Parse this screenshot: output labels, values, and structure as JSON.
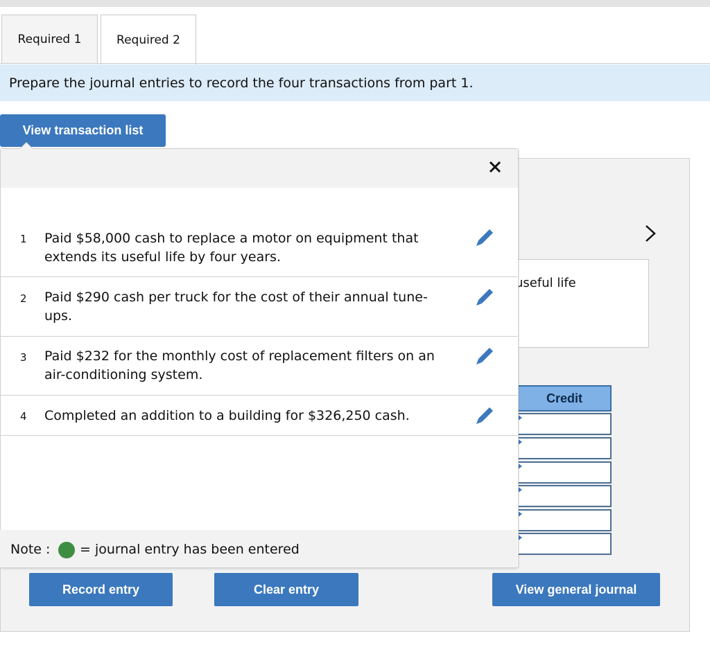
{
  "tabs": [
    {
      "label": "Required 1"
    },
    {
      "label": "Required 2"
    }
  ],
  "instruction": "Prepare the journal entries to record the four transactions from part 1.",
  "view_transaction_list_label": "View transaction list",
  "background_form": {
    "description_fragment": "useful life",
    "credit_header": "Credit"
  },
  "transactions": [
    {
      "num": "1",
      "text": "Paid $58,000 cash to replace a motor on equipment that extends its useful life by four years."
    },
    {
      "num": "2",
      "text": "Paid $290 cash per truck for the cost of their annual tune-ups."
    },
    {
      "num": "3",
      "text": "Paid $232 for the monthly cost of replacement filters on an air-conditioning system."
    },
    {
      "num": "4",
      "text": "Completed an addition to a building for $326,250 cash."
    }
  ],
  "note": {
    "label": "Note :",
    "text": "= journal entry has been entered",
    "dot_color": "#3e8e41"
  },
  "buttons": {
    "record": "Record entry",
    "clear": "Clear entry",
    "view_general_journal": "View general journal"
  },
  "colors": {
    "accent": "#3b78bd",
    "instruction_bg": "#dcecf8",
    "credit_header_bg": "#7fb0e6"
  }
}
